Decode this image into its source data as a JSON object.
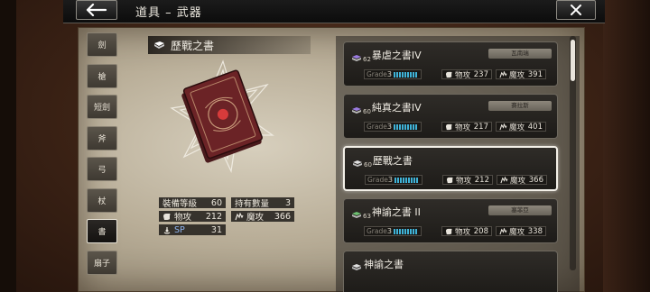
{
  "header": {
    "title": "道具 – 武器"
  },
  "tabs": [
    "劍",
    "槍",
    "短劍",
    "斧",
    "弓",
    "杖",
    "書",
    "扇子"
  ],
  "active_tab": "書",
  "detail": {
    "name": "歷戰之書",
    "stats": {
      "equip_level_label": "裝備等級",
      "equip_level": "60",
      "owned_label": "持有數量",
      "owned": "3",
      "phys_label": "物攻",
      "phys": "212",
      "magic_label": "魔攻",
      "magic": "366",
      "sp_label": "SP",
      "sp": "31"
    }
  },
  "items": [
    {
      "level": "62",
      "name": "暴虐之書IV",
      "tag": "瓦南瑞",
      "grade_label": "Grade",
      "grade": "3",
      "phys_label": "物攻",
      "phys": "237",
      "magic_label": "魔攻",
      "magic": "391",
      "pips": 9,
      "icon_color": "#9a7be0",
      "selected": false
    },
    {
      "level": "60",
      "name": "純真之書IV",
      "tag": "賽拉斯",
      "grade_label": "Grade",
      "grade": "3",
      "phys_label": "物攻",
      "phys": "217",
      "magic_label": "魔攻",
      "magic": "401",
      "pips": 9,
      "icon_color": "#9a7be0",
      "selected": false
    },
    {
      "level": "60",
      "name": "歷戰之書",
      "tag": "",
      "grade_label": "Grade",
      "grade": "3",
      "phys_label": "物攻",
      "phys": "212",
      "magic_label": "魔攻",
      "magic": "366",
      "pips": 9,
      "icon_color": "#e0e0e0",
      "selected": true
    },
    {
      "level": "63",
      "name": "神諭之書 II",
      "tag": "塞菲亞",
      "grade_label": "Grade",
      "grade": "3",
      "phys_label": "物攻",
      "phys": "208",
      "magic_label": "魔攻",
      "magic": "338",
      "pips": 9,
      "icon_color": "#6cc070",
      "selected": false
    },
    {
      "level": "",
      "name": "神諭之書",
      "tag": "",
      "grade_label": "",
      "grade": "",
      "phys_label": "",
      "phys": "",
      "magic_label": "",
      "magic": "",
      "pips": 0,
      "icon_color": "#e0e0e0",
      "selected": false
    }
  ],
  "icons": {
    "back": "arrow-left-icon",
    "close": "close-icon",
    "book": "book-icon",
    "phys": "fist-icon",
    "magic": "magic-hand-icon",
    "sp": "sp-icon"
  }
}
